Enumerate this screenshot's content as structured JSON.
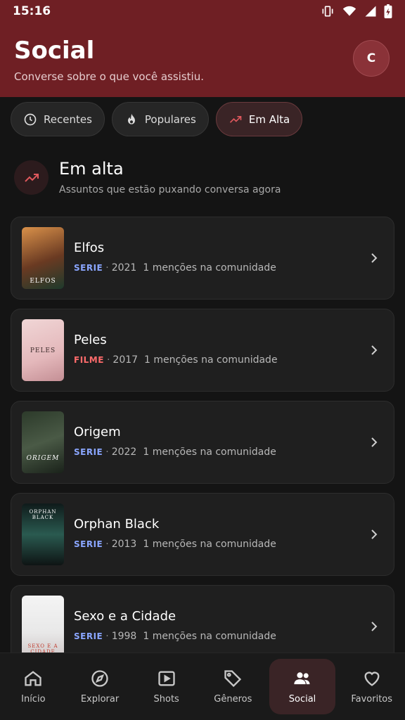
{
  "status": {
    "time": "15:16"
  },
  "header": {
    "title": "Social",
    "subtitle": "Converse sobre o que você assistiu.",
    "avatar_initial": "C"
  },
  "chips": [
    {
      "label": "Recentes",
      "icon": "clock-icon"
    },
    {
      "label": "Populares",
      "icon": "flame-icon"
    },
    {
      "label": "Em Alta",
      "icon": "trending-icon",
      "active": true
    }
  ],
  "section": {
    "title": "Em alta",
    "subtitle": "Assuntos que estão puxando conversa agora"
  },
  "items": [
    {
      "title": "Elfos",
      "type": "SERIE",
      "year": "2021",
      "mentions": "1 menções na comunidade",
      "poster_text": "ELFOS"
    },
    {
      "title": "Peles",
      "type": "FILME",
      "year": "2017",
      "mentions": "1 menções na comunidade",
      "poster_text": "PELES"
    },
    {
      "title": "Origem",
      "type": "SERIE",
      "year": "2022",
      "mentions": "1 menções na comunidade",
      "poster_text": "ORIGEM"
    },
    {
      "title": "Orphan Black",
      "type": "SERIE",
      "year": "2013",
      "mentions": "1 menções na comunidade",
      "poster_text": "ORPHAN BLACK"
    },
    {
      "title": "Sexo e a Cidade",
      "type": "SERIE",
      "year": "1998",
      "mentions": "1 menções na comunidade",
      "poster_text": "SEXO E A CIDADE"
    }
  ],
  "nav": [
    {
      "label": "Início",
      "icon": "home-icon"
    },
    {
      "label": "Explorar",
      "icon": "compass-icon"
    },
    {
      "label": "Shots",
      "icon": "play-icon"
    },
    {
      "label": "Gêneros",
      "icon": "tag-icon"
    },
    {
      "label": "Social",
      "icon": "people-icon",
      "active": true
    },
    {
      "label": "Favoritos",
      "icon": "heart-icon"
    }
  ],
  "colors": {
    "header": "#6f1f24",
    "accent": "#e0585d",
    "serie": "#8aa6ff",
    "filme": "#ff6b6b"
  }
}
